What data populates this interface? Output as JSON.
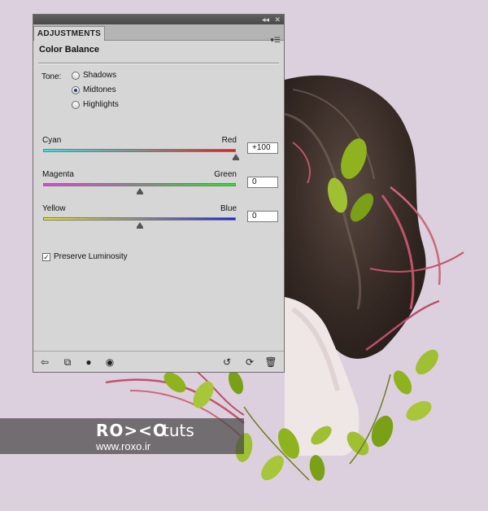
{
  "panel": {
    "tab_label": "ADJUSTMENTS",
    "heading": "Color Balance",
    "tone_label": "Tone:",
    "tone_options": [
      "Shadows",
      "Midtones",
      "Highlights"
    ],
    "tone_selected": "Midtones",
    "sliders": [
      {
        "left_label": "Cyan",
        "right_label": "Red",
        "value": "+100",
        "level": 100,
        "colors": [
          "#3fe3e6",
          "#e61a1a"
        ]
      },
      {
        "left_label": "Magenta",
        "right_label": "Green",
        "value": "0",
        "level": 0,
        "colors": [
          "#e63ee6",
          "#28e628"
        ]
      },
      {
        "left_label": "Yellow",
        "right_label": "Blue",
        "value": "0",
        "level": 0,
        "colors": [
          "#e6e61e",
          "#1e1ee6"
        ]
      }
    ],
    "preserve_luminosity_label": "Preserve Luminosity",
    "preserve_luminosity_checked": true
  },
  "watermark": {
    "logo": "RO><O",
    "tuts": "tuts",
    "url": "www.roxo.ir"
  }
}
